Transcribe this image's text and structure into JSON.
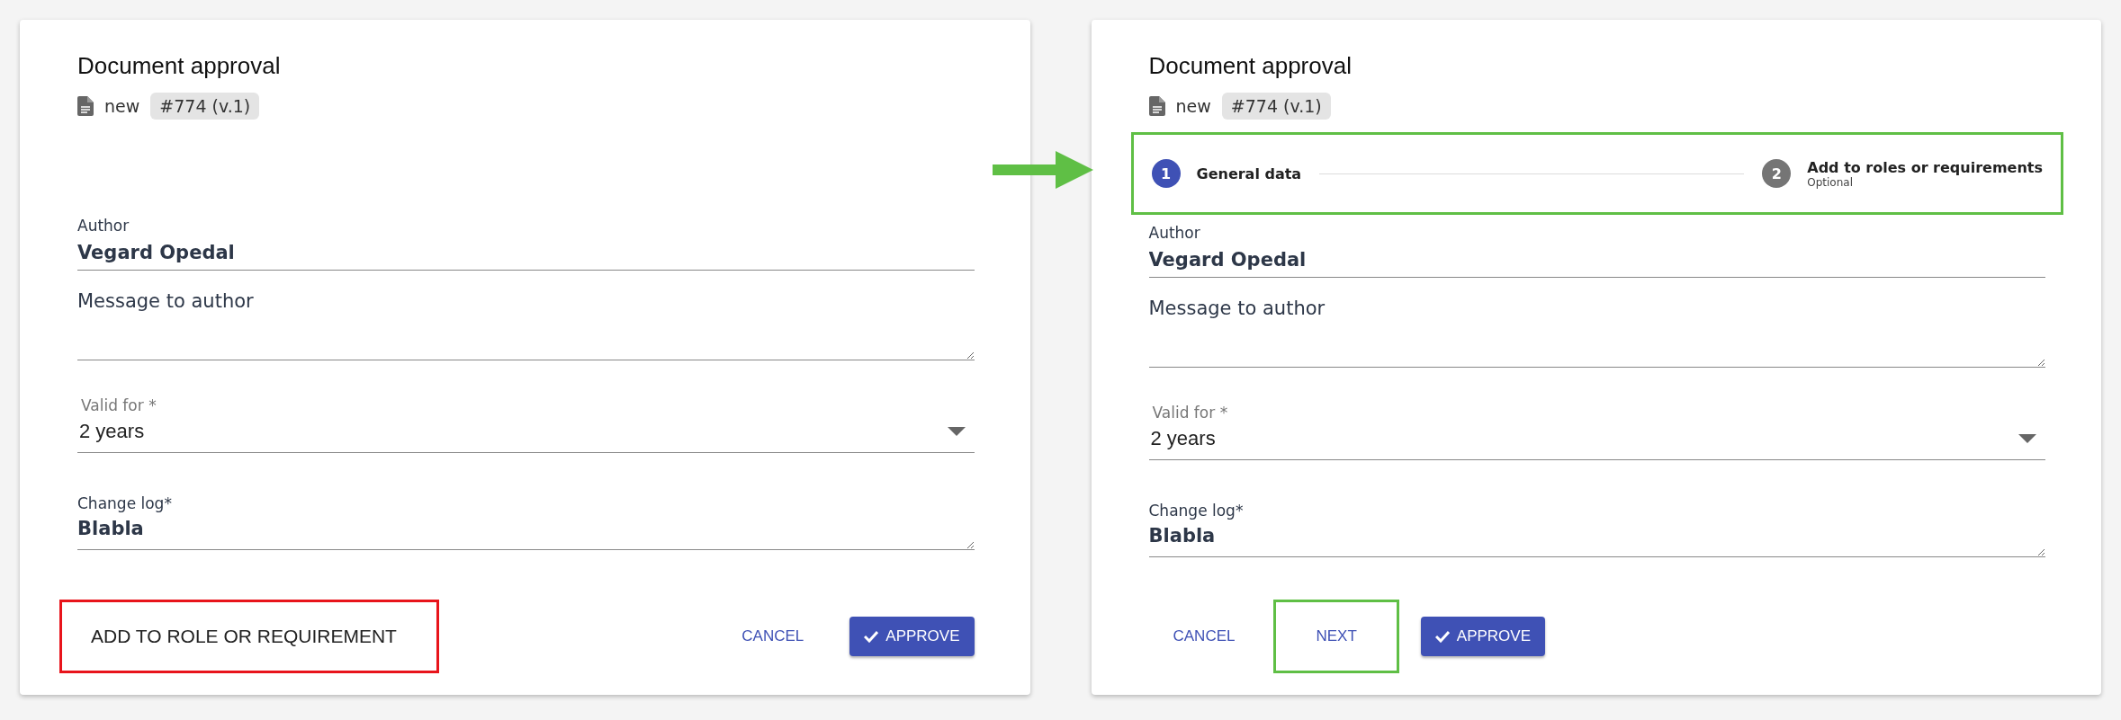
{
  "panels": [
    {
      "title": "Document approval",
      "status": "new",
      "version": "#774 (v.1)",
      "fields": [
        {
          "kind": "text",
          "label": "Author",
          "value": "Vegard Opedal"
        },
        {
          "kind": "textarea",
          "placeholder": "Message to author"
        },
        {
          "kind": "select",
          "label": "Valid for *",
          "value": "2 years"
        },
        {
          "kind": "textarea",
          "label": "Change log*",
          "value": "Blabla"
        }
      ],
      "actions": [
        {
          "kind": "plain",
          "label": "ADD TO ROLE OR REQUIREMENT",
          "color": "#e8141b"
        },
        {
          "kind": "text",
          "label": "CANCEL"
        },
        {
          "kind": "raised",
          "label": "APPROVE"
        }
      ]
    },
    {
      "title": "Document approval",
      "status": "new",
      "version": "#774 (v.1)",
      "stepper": {
        "color": "#5fbf45",
        "steps": [
          {
            "number": "1",
            "label": "General data",
            "selected": true
          },
          {
            "number": "2",
            "label": "Add to roles or requirements",
            "sublabel": "Optional",
            "selected": false
          }
        ]
      },
      "fields": [
        {
          "kind": "text",
          "label": "Author",
          "value": "Vegard Opedal"
        },
        {
          "kind": "textarea",
          "placeholder": "Message to author"
        },
        {
          "kind": "select",
          "label": "Valid for *",
          "value": "2 years"
        },
        {
          "kind": "textarea",
          "label": "Change log*",
          "value": "Blabla"
        }
      ],
      "actions": [
        {
          "kind": "text",
          "label": "CANCEL"
        },
        {
          "kind": "text",
          "label": "NEXT",
          "color": "#5fbf45"
        },
        {
          "kind": "raised",
          "label": "APPROVE"
        }
      ]
    }
  ]
}
